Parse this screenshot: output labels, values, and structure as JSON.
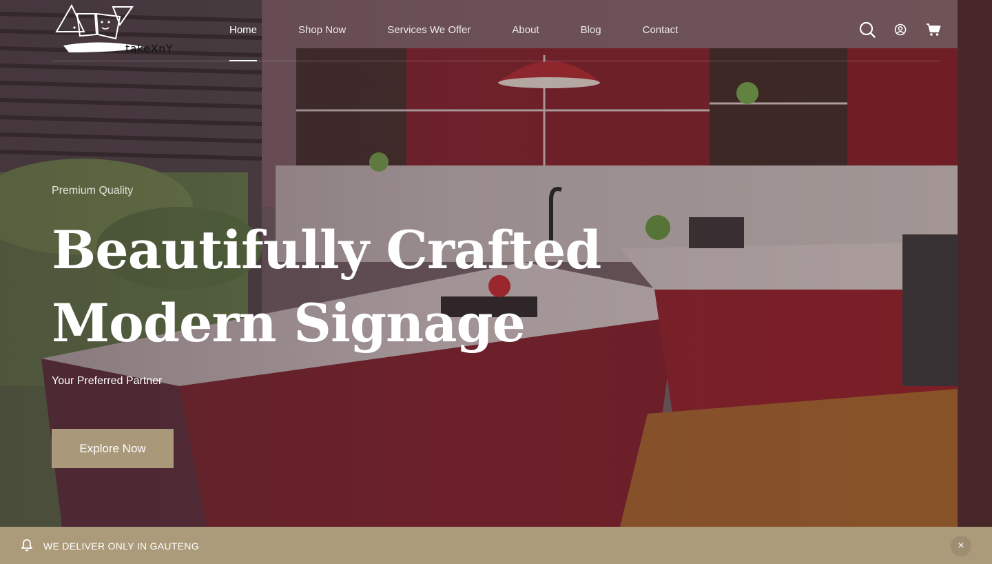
{
  "brand": {
    "logo_text": "takeXnY"
  },
  "nav": {
    "items": [
      {
        "label": "Home",
        "active": true
      },
      {
        "label": "Shop Now",
        "active": false
      },
      {
        "label": "Services We Offer",
        "active": false
      },
      {
        "label": "About",
        "active": false
      },
      {
        "label": "Blog",
        "active": false
      },
      {
        "label": "Contact",
        "active": false
      }
    ]
  },
  "header_icons": [
    "search-icon",
    "account-icon",
    "cart-icon"
  ],
  "hero": {
    "eyebrow": "Premium Quality",
    "headline_line1": "Beautifully Crafted",
    "headline_line2": "Modern Signage",
    "subtitle": "Your Preferred Partner",
    "cta_label": "Explore Now"
  },
  "announcement": {
    "icon": "bell-icon",
    "message": "WE DELIVER ONLY IN GAUTENG",
    "close_label": "×"
  },
  "colors": {
    "accent": "#ab9b7b",
    "cta": "#a9997a",
    "text": "#ffffff"
  }
}
